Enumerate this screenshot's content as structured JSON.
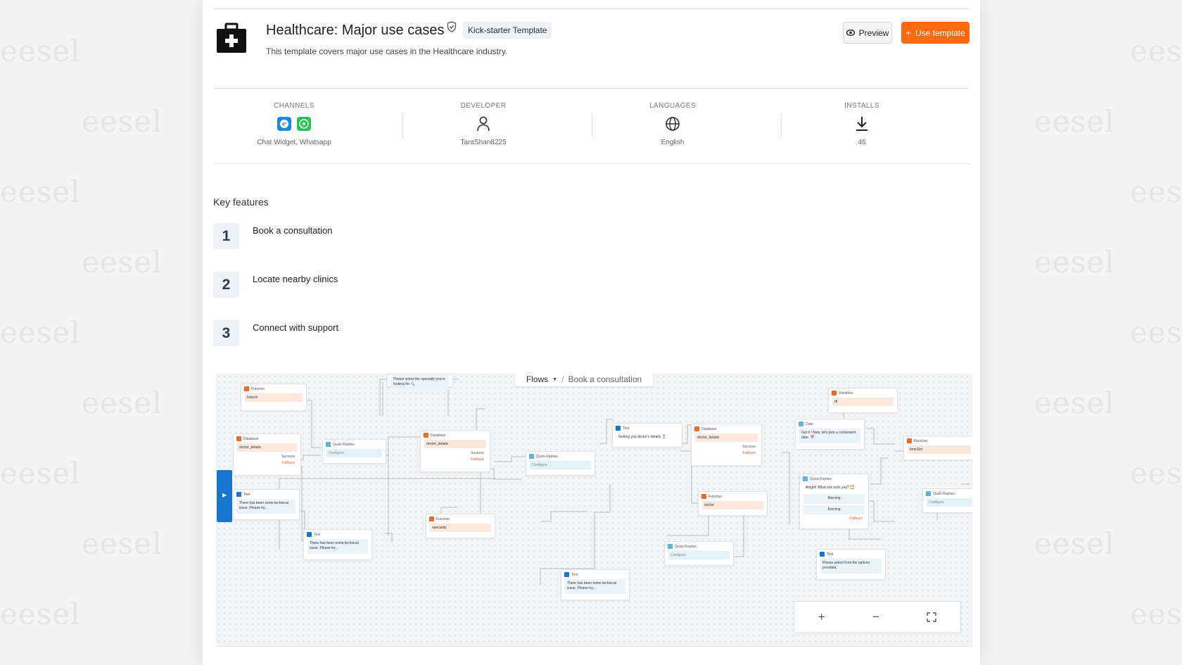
{
  "watermark": "eesel",
  "header": {
    "title": "Healthcare: Major use cases",
    "badge": "Kick-starter Template",
    "description": "This template covers major use cases in the Healthcare industry.",
    "preview_label": "Preview",
    "use_label": "Use template",
    "accent": "#fd6a10"
  },
  "meta": [
    {
      "label": "CHANNELS",
      "value": "Chat Widget, Whatsapp"
    },
    {
      "label": "DEVELOPER",
      "value": "TaraShan8225"
    },
    {
      "label": "LANGUAGES",
      "value": "English"
    },
    {
      "label": "INSTALLS",
      "value": "46"
    }
  ],
  "features": {
    "title": "Key features",
    "items": [
      {
        "num": "1",
        "label": "Book a consultation"
      },
      {
        "num": "2",
        "label": "Locate nearby clinics"
      },
      {
        "num": "3",
        "label": "Connect with support"
      }
    ]
  },
  "flow": {
    "breadcrumb_root": "Flows",
    "breadcrumb_sep": "/",
    "breadcrumb_current": "Book a consultation",
    "zoom_in": "+",
    "zoom_out": "−",
    "top_snippet": "Please select the specialty you're looking for 🔍",
    "nodes": {
      "n1": {
        "type": "Function",
        "field": "branch"
      },
      "n2": {
        "type": "Database",
        "field": "doctor_details",
        "success": "Success",
        "fallback": "Fallback"
      },
      "n3": {
        "type": "Quick Replies",
        "field": "Configure"
      },
      "n4": {
        "type": "Text",
        "field": "There has been some technical issue. Please try..."
      },
      "n5": {
        "type": "Text",
        "field": "There has been some technical issue. Please try..."
      },
      "n6": {
        "type": "Database",
        "field": "doctor_details",
        "success": "Success",
        "fallback": "Fallback"
      },
      "n7": {
        "type": "Function",
        "field": "speciality"
      },
      "n8": {
        "type": "Quick Replies",
        "field": "Configure"
      },
      "n9": {
        "type": "Text",
        "field": "Getting you doctor's details ⏳"
      },
      "n10": {
        "type": "Text",
        "field": "There has been some technical issue. Please try..."
      },
      "n11": {
        "type": "Database",
        "field": "doctor_details",
        "success": "Success",
        "fallback": "Fallback"
      },
      "n12": {
        "type": "Function",
        "field": "doctor"
      },
      "n13": {
        "type": "Quick Replies",
        "field": "Configure"
      },
      "n14": {
        "type": "Variables",
        "field": "dt"
      },
      "n15": {
        "type": "Date",
        "field": "Got it ! Now, let's pick a convenient date. 📅"
      },
      "n16": {
        "type": "Quick Replies",
        "field": "Alright! What slot suits you? 🌅",
        "opt1": "Morning",
        "opt2": "Evening",
        "fallback": "Fallback"
      },
      "n17": {
        "type": "Text",
        "field": "Please select from the options provided."
      },
      "n18": {
        "type": "Function",
        "field": "timeSlot"
      },
      "n19": {
        "type": "Quick Replies",
        "field": "Configure"
      }
    }
  }
}
